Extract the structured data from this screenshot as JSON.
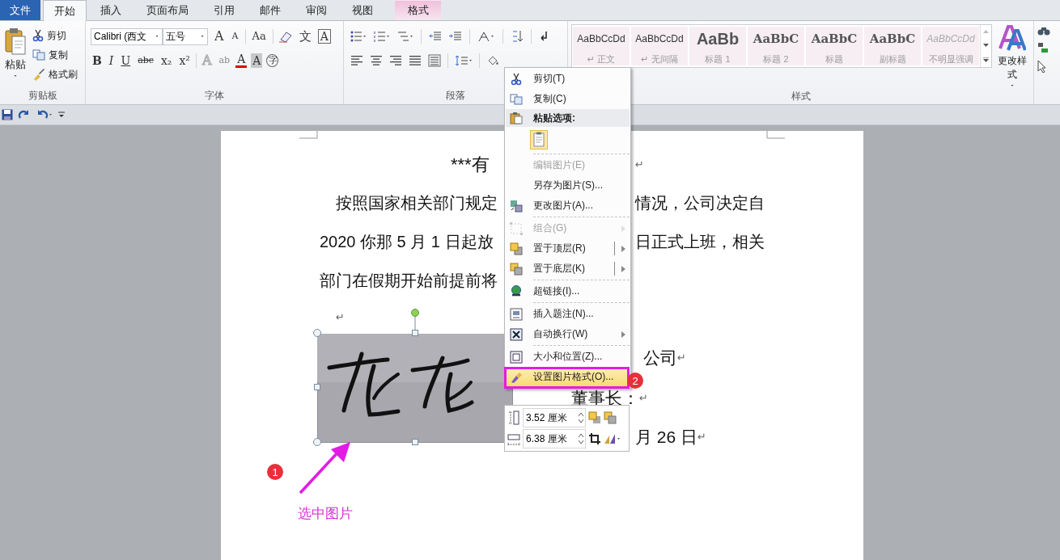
{
  "tabs": [
    {
      "label": "文件",
      "kind": "file",
      "selected": false
    },
    {
      "label": "开始",
      "kind": "tab",
      "selected": true
    },
    {
      "label": "插入",
      "kind": "tab",
      "selected": false
    },
    {
      "label": "页面布局",
      "kind": "tab",
      "selected": false
    },
    {
      "label": "引用",
      "kind": "tab",
      "selected": false
    },
    {
      "label": "邮件",
      "kind": "tab",
      "selected": false
    },
    {
      "label": "审阅",
      "kind": "tab",
      "selected": false
    },
    {
      "label": "视图",
      "kind": "tab",
      "selected": false
    },
    {
      "label": "格式",
      "kind": "context",
      "selected": false
    }
  ],
  "clipboard": {
    "paste": "粘贴",
    "cut": "剪切",
    "copy": "复制",
    "format_painter": "格式刷",
    "label": "剪贴板"
  },
  "font": {
    "font_name": "Calibri (西文",
    "font_size": "五号",
    "label": "字体",
    "row1": [
      {
        "text": "A",
        "kind": "grow"
      },
      {
        "text": "A",
        "kind": "shrink"
      },
      {
        "text": "Aa",
        "kind": "case"
      },
      {
        "text": "文",
        "kind": "phonetic"
      },
      {
        "text": "A",
        "kind": "border"
      }
    ],
    "row2": [
      {
        "text": "B",
        "kind": "bold"
      },
      {
        "text": "I",
        "kind": "italic"
      },
      {
        "text": "U",
        "kind": "underline"
      },
      {
        "text": "abc",
        "kind": "strike"
      },
      {
        "text": "x₂",
        "kind": "sub"
      },
      {
        "text": "x²",
        "kind": "sup"
      },
      {
        "text": "A",
        "kind": "effect"
      },
      {
        "text": "ab",
        "kind": "highlight"
      },
      {
        "text": "A",
        "kind": "color"
      },
      {
        "text": "A",
        "kind": "shade"
      },
      {
        "text": "字",
        "kind": "enclose"
      }
    ]
  },
  "paragraph": {
    "label": "段落"
  },
  "styles": {
    "label": "样式",
    "change_styles": "更改样式",
    "items": [
      {
        "sample": "AaBbCcDd",
        "label": "↵ 正文",
        "kind": "normal"
      },
      {
        "sample": "AaBbCcDd",
        "label": "↵ 无间隔",
        "kind": "normal"
      },
      {
        "sample": "AaBb",
        "label": "标题 1",
        "kind": "heading1"
      },
      {
        "sample": "AaBbC",
        "label": "标题 2",
        "kind": "heading2"
      },
      {
        "sample": "AaBbC",
        "label": "标题",
        "kind": "title"
      },
      {
        "sample": "AaBbC",
        "label": "副标题",
        "kind": "subtitle"
      },
      {
        "sample": "AaBbCcDd",
        "label": "不明显强调",
        "kind": "subtle"
      }
    ]
  },
  "document": {
    "lines": [
      {
        "kind": "title",
        "left": "***有",
        "mark": "↵"
      },
      {
        "kind": "indent",
        "left": "按照国家相关部门规定",
        "right": "情况，公司决定自"
      },
      {
        "kind": "plain",
        "left": "2020 你那 5 月 1 日起放",
        "right": "日正式上班，相关"
      },
      {
        "kind": "plain",
        "left": "部门在假期开始前提前将"
      },
      {
        "kind": "blank",
        "mark": "↵"
      }
    ],
    "signature": [
      {
        "text": "公司",
        "mark": "↵"
      },
      {
        "text": "董事长：",
        "mark": "↵"
      },
      {
        "text": "月 26 日",
        "mark": "↵"
      }
    ]
  },
  "context_menu": {
    "items": [
      {
        "kind": "item",
        "label": "剪切(T)",
        "disabled": false,
        "submenu": false,
        "split": false,
        "selected": false,
        "separator_after": false
      },
      {
        "kind": "item",
        "label": "复制(C)",
        "disabled": false,
        "submenu": false,
        "split": false,
        "selected": false,
        "separator_after": false
      },
      {
        "kind": "header",
        "label": "粘贴选项:",
        "disabled": false,
        "submenu": false,
        "split": false,
        "selected": false,
        "separator_after": false
      },
      {
        "kind": "paste",
        "disabled": false,
        "submenu": false,
        "split": false,
        "selected": false,
        "separator_after": true
      },
      {
        "kind": "item",
        "label": "编辑图片(E)",
        "disabled": true,
        "submenu": false,
        "split": false,
        "selected": false,
        "separator_after": false
      },
      {
        "kind": "item",
        "label": "另存为图片(S)...",
        "disabled": false,
        "submenu": false,
        "split": false,
        "selected": false,
        "separator_after": false
      },
      {
        "kind": "item",
        "label": "更改图片(A)...",
        "disabled": false,
        "submenu": false,
        "split": false,
        "selected": false,
        "separator_after": true
      },
      {
        "kind": "item",
        "label": "组合(G)",
        "disabled": true,
        "submenu": true,
        "split": false,
        "selected": false,
        "separator_after": false
      },
      {
        "kind": "item",
        "label": "置于顶层(R)",
        "disabled": false,
        "submenu": true,
        "split": true,
        "selected": false,
        "separator_after": false
      },
      {
        "kind": "item",
        "label": "置于底层(K)",
        "disabled": false,
        "submenu": true,
        "split": true,
        "selected": false,
        "separator_after": true
      },
      {
        "kind": "item",
        "label": "超链接(I)...",
        "disabled": false,
        "submenu": false,
        "split": false,
        "selected": false,
        "separator_after": true
      },
      {
        "kind": "item",
        "label": "插入题注(N)...",
        "disabled": false,
        "submenu": false,
        "split": false,
        "selected": false,
        "separator_after": false
      },
      {
        "kind": "item",
        "label": "自动换行(W)",
        "disabled": false,
        "submenu": true,
        "split": false,
        "selected": false,
        "separator_after": true
      },
      {
        "kind": "item",
        "label": "大小和位置(Z)...",
        "disabled": false,
        "submenu": false,
        "split": false,
        "selected": false,
        "separator_after": false
      },
      {
        "kind": "item",
        "label": "设置图片格式(O)...",
        "disabled": false,
        "submenu": false,
        "split": false,
        "selected": true,
        "separator_after": false
      }
    ]
  },
  "size_toolbar": {
    "height": "3.52 厘米",
    "width": "6.38 厘米"
  },
  "annotations": {
    "steps": [
      "1",
      "2"
    ],
    "caption": "选中图片"
  }
}
